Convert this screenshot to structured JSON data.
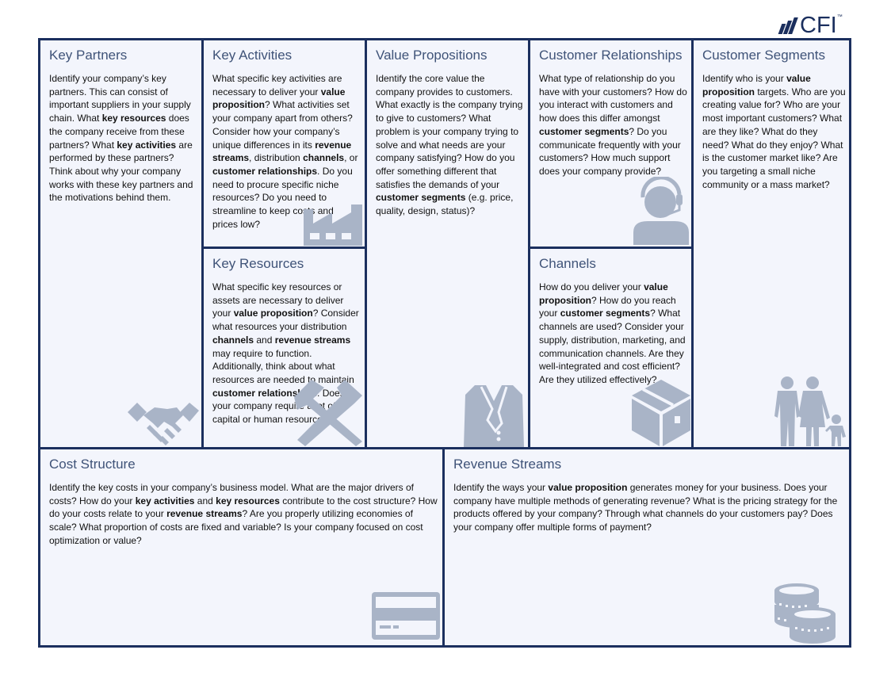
{
  "brand": {
    "logo_text": "CFI",
    "trademark": "™"
  },
  "colors": {
    "border": "#1b2f5e",
    "background": "#f3f5fc",
    "icon": "#a9b4c7",
    "title": "#3f5378"
  },
  "blocks": {
    "key_partners": {
      "title": "Key Partners",
      "segments": [
        {
          "t": "Identify your company’s key partners. This can consist of important suppliers in your supply chain. What "
        },
        {
          "t": "key resources",
          "b": true
        },
        {
          "t": " does the company receive from these partners? What "
        },
        {
          "t": "key activities",
          "b": true
        },
        {
          "t": " are performed by these partners? Think about why your company works with these key partners and the motivations behind them."
        }
      ],
      "icon": "handshake-icon"
    },
    "key_activities": {
      "title": "Key Activities",
      "segments": [
        {
          "t": "What specific key activities are necessary to deliver your "
        },
        {
          "t": "value proposition",
          "b": true
        },
        {
          "t": "? What activities set your company apart from others? Consider how your company’s unique differences in its "
        },
        {
          "t": "revenue streams",
          "b": true
        },
        {
          "t": ", distribution "
        },
        {
          "t": "channels",
          "b": true
        },
        {
          "t": ", or "
        },
        {
          "t": "customer relationships",
          "b": true
        },
        {
          "t": ". Do you need to procure specific niche resources? Do you need to streamline to keep costs and prices low?"
        }
      ],
      "icon": "factory-icon"
    },
    "key_resources": {
      "title": "Key Resources",
      "segments": [
        {
          "t": "What specific key resources or assets are necessary to deliver your "
        },
        {
          "t": "value proposition",
          "b": true
        },
        {
          "t": "? Consider what resources your distribution "
        },
        {
          "t": "channels",
          "b": true
        },
        {
          "t": " and "
        },
        {
          "t": "revenue streams",
          "b": true
        },
        {
          "t": " may require to function. Additionally, think about what resources are needed to maintain "
        },
        {
          "t": "customer relationships",
          "b": true
        },
        {
          "t": ". Does your company require a lot of capital or human resources?"
        }
      ],
      "icon": "hammer-pick-icon"
    },
    "value_propositions": {
      "title": "Value Propositions",
      "segments": [
        {
          "t": "Identify the core value the company provides to customers. What exactly is the company trying to give to customers? What problem is your company trying to solve and what needs are your company satisfying? How do you offer something different that satisfies the demands of your "
        },
        {
          "t": "customer segments",
          "b": true
        },
        {
          "t": " (e.g. price, quality, design, status)?"
        }
      ],
      "icon": "suit-jacket-icon"
    },
    "customer_relationships": {
      "title": "Customer Relationships",
      "segments": [
        {
          "t": "What type of relationship do you have with your customers? How do you interact with customers and how does this differ amongst "
        },
        {
          "t": "customer segments",
          "b": true
        },
        {
          "t": "? Do you communicate frequently with your customers? How much support does your company provide?"
        }
      ],
      "icon": "headset-agent-icon"
    },
    "channels": {
      "title": "Channels",
      "segments": [
        {
          "t": "How do you deliver your "
        },
        {
          "t": "value proposition",
          "b": true
        },
        {
          "t": "? How do you reach your "
        },
        {
          "t": "customer segments",
          "b": true
        },
        {
          "t": "? What channels are used? Consider your supply, distribution, marketing, and communication channels. Are they well-integrated and cost efficient? Are they utilized effectively?"
        }
      ],
      "icon": "box-package-icon"
    },
    "customer_segments": {
      "title": "Customer Segments",
      "segments": [
        {
          "t": "Identify who is your "
        },
        {
          "t": "value proposition",
          "b": true
        },
        {
          "t": " targets. Who are you creating value for? Who are your most important customers? What are they like? What do they need? What do they enjoy? What is the customer market like? Are you targeting a small niche community or a mass market?"
        }
      ],
      "icon": "family-icon"
    },
    "cost_structure": {
      "title": "Cost Structure",
      "segments": [
        {
          "t": "Identify the key costs in your company’s business model. What are the major drivers of costs? How do your "
        },
        {
          "t": "key activities",
          "b": true
        },
        {
          "t": " and "
        },
        {
          "t": "key resources",
          "b": true
        },
        {
          "t": " contribute to the cost structure? How do your costs relate to your "
        },
        {
          "t": "revenue streams",
          "b": true
        },
        {
          "t": "? Are you properly utilizing economies of scale? What proportion of costs are fixed and variable? Is your company focused on cost optimization or value?"
        }
      ],
      "icon": "credit-card-icon"
    },
    "revenue_streams": {
      "title": "Revenue Streams",
      "segments": [
        {
          "t": "Identify the ways your "
        },
        {
          "t": "value proposition",
          "b": true
        },
        {
          "t": " generates money for your business. Does your company have multiple methods of generating revenue? What is the pricing strategy for the products offered by your company? Through what channels do your customers pay? Does your company offer multiple forms of payment?"
        }
      ],
      "icon": "coins-icon"
    }
  }
}
